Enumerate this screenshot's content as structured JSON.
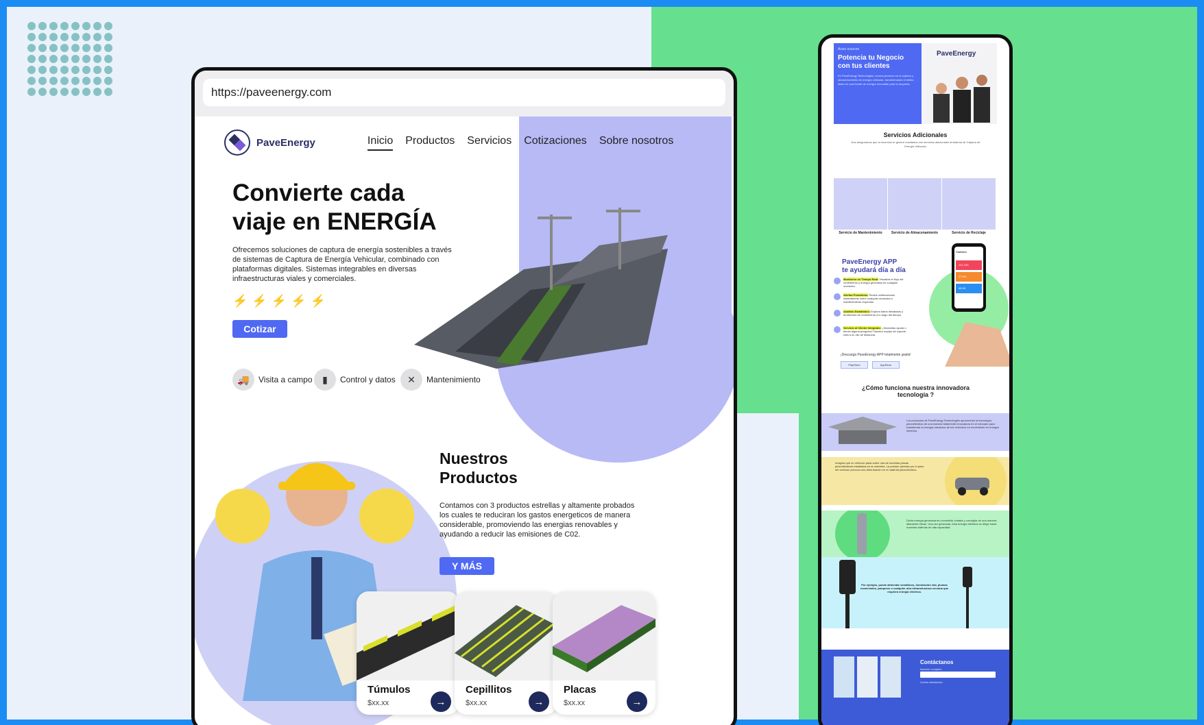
{
  "browser": {
    "url": "https://paveenergy.com"
  },
  "site": {
    "brand": "PaveEnergy",
    "nav": [
      "Inicio",
      "Productos",
      "Servicios",
      "Cotizaciones",
      "Sobre nosotros"
    ],
    "hero": {
      "title_line1": "Convierte cada",
      "title_line2": "viaje en ENERGÍA",
      "description": "Ofrecemos soluciones de captura de energía sostenibles a través de sistemas de Captura de Energía Vehicular, combinado con plataformas digitales. Sistemas integrables en diversas infraestructuras viales y comerciales.",
      "cta": "Cotizar"
    },
    "features": [
      {
        "icon": "truck-icon",
        "label": "Visita a campo"
      },
      {
        "icon": "bar-chart-icon",
        "label": "Control y datos"
      },
      {
        "icon": "tools-icon",
        "label": "Mantenimiento"
      }
    ],
    "products": {
      "title_line1": "Nuestros",
      "title_line2": "Productos",
      "description": "Contamos con 3 productos estrellas y altamente probados los cuales te reduciran los gastos energeticos de manera considerable, promoviendo las energias renovables y ayudando a reducir las emisiones de C02.",
      "cta": "Y MÁS",
      "items": [
        {
          "name": "Túmulos",
          "price": "$xx.xx"
        },
        {
          "name": "Cepillitos",
          "price": "$xx.xx"
        },
        {
          "name": "Placas",
          "price": "$xx.xx"
        }
      ]
    }
  },
  "mobile": {
    "header": {
      "tag": "Aviso sourcee",
      "title": "Potencia tu Negocio con tus clientes",
      "body": "En PaveEnergy Technologies, somos pioneros en la captura y almacenamiento de energía vehicular, transformando el tráfico diario en una fuente de energía renovable para tu empresa.",
      "brand": "PaveEnergy"
    },
    "services": {
      "title": "Servicios Adicionales",
      "subtitle": "Nos aseguramos que tu inversión te genere resultados con servicios adicionales al sistema de Captura de Energía Vehicular.",
      "items": [
        "Servicio de Mantenimiento",
        "Servicio de Almacenamiento",
        "Servicio de Reciclaje"
      ]
    },
    "app": {
      "title_line1": "PaveEnergy APP",
      "title_line2": "te ayudará día a día",
      "items": [
        {
          "highlight": "Monitoreo en Tiempo Real:",
          "text": "Visualiza el flujo del rendimiento y energía generada en cualquier momento."
        },
        {
          "highlight": "Alertas Proactivas:",
          "text": "Recibe notificaciones instantáneas sobre cualquier anomalía o mantenimiento requerido."
        },
        {
          "highlight": "Análisis Estadístico:",
          "text": "Explora datos detallados y tendencias de rendimiento a lo largo del tiempo."
        },
        {
          "highlight": "Servicio al Cliente Integrado:",
          "text": "¿Necesitas ayuda o tienes alguna pregunta? Nuestro equipo de soporte está a un clic de distancia."
        }
      ],
      "download": "¡Descarga PaveEnergy APP totalmente gratis!",
      "stores": [
        "PlayStore",
        "AppStore"
      ],
      "screen": {
        "label": "Statistics",
        "values": [
          "121.425",
          "27.5%",
          "68.08"
        ]
      }
    },
    "how": {
      "title": "¿Cómo funciona nuestra innovadora tecnología ?",
      "steps": [
        "Los productos de PaveEnergy Technologies aprovechan la tecnología piezoeléctrica de una manera totalmente innovadora en el mercado para transformar la energía mecánica de los vehículos en movimiento en energía eléctrica.",
        "Imagina que un vehículo pasa sobre una de nuestras placas piezoeléctricas instaladas en la carretera. La presión ejercida por el peso del vehículo provoca una deformación en el material piezoeléctrico.",
        "Dicha energía generada es convertida, tratada y corregida de una manera altamente eficaz. Una vez generada, esta energía eléctrica se dirige hacia nuestras baterías de alta capacidad.",
        "Por ejemplo, puede alimentar semáforos, iluminación vial, plumas comerciales, parqueos o cualquier otra infraestructura cercana que requiera energía eléctrica."
      ]
    },
    "contact": {
      "title": "Contáctanos",
      "labels": [
        "Nombre completo",
        "Correo electrónico"
      ]
    }
  }
}
